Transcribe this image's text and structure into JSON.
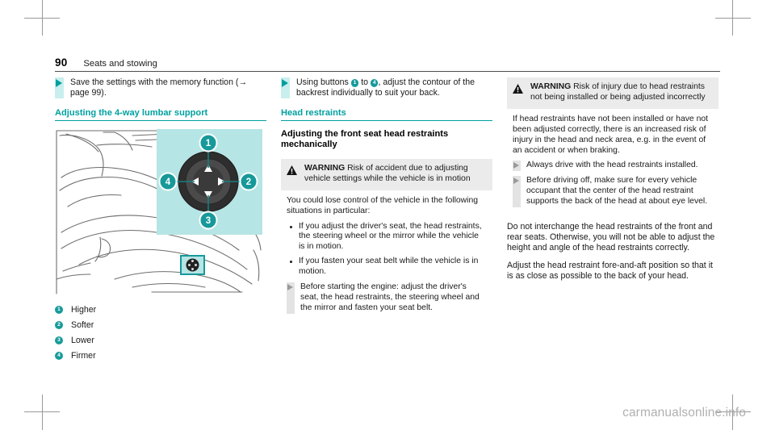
{
  "page": {
    "number": "90",
    "chapter": "Seats and stowing",
    "watermark": "carmanualsonline.info"
  },
  "colors": {
    "teal": "#00a0a0",
    "teal_badge": "#179b9b",
    "teal_tint": "#c9eeee",
    "warn_head_bg": "#ebebeb",
    "gray_marker": "#9a9a9a"
  },
  "left_column": {
    "step": {
      "text": "Save the settings with the memory function (→ page 99)."
    },
    "heading": "Adjusting the 4-way lumbar support",
    "figure": {
      "name": "4-way-lumbar-support-control",
      "callouts": [
        "1",
        "2",
        "3",
        "4"
      ],
      "arrow_directions": [
        "up",
        "right",
        "down",
        "left"
      ]
    },
    "legend": [
      {
        "num": "1",
        "label": "Higher"
      },
      {
        "num": "2",
        "label": "Softer"
      },
      {
        "num": "3",
        "label": "Lower"
      },
      {
        "num": "4",
        "label": "Firmer"
      }
    ]
  },
  "middle_column": {
    "step": {
      "prefix": "Using buttons",
      "badge_from": "1",
      "mid": "to",
      "badge_to": "4",
      "suffix": ", adjust the contour of the backrest individually to suit your back."
    },
    "heading": "Head restraints",
    "sub_heading": "Adjusting the front seat head restraints mechanically",
    "warning": {
      "label": "WARNING",
      "title": "Risk of accident due to adjusting vehicle settings while the vehicle is in motion",
      "intro": "You could lose control of the vehicle in the following situations in particular:",
      "bullets": [
        "If you adjust the driver's seat, the head restraints, the steering wheel or the mirror while the vehicle is in motion.",
        "If you fasten your seat belt while the vehicle is in motion."
      ],
      "steps": [
        "Before starting the engine: adjust the driver's seat, the head restraints, the steering wheel and the mirror and fasten your seat belt."
      ]
    }
  },
  "right_column": {
    "warning": {
      "label": "WARNING",
      "title": "Risk of injury due to head restraints not being installed or being adjusted incorrectly",
      "intro": "If head restraints have not been installed or have not been adjusted correctly, there is an increased risk of injury in the head and neck area, e.g. in the event of an accident or when braking.",
      "steps": [
        "Always drive with the head restraints installed.",
        "Before driving off, make sure for every vehicle occupant that the center of the head restraint supports the back of the head at about eye level."
      ]
    },
    "paragraphs": [
      "Do not interchange the head restraints of the front and rear seats. Otherwise, you will not be able to adjust the height and angle of the head restraints correctly.",
      "Adjust the head restraint fore-and-aft position so that it is as close as possible to the back of your head."
    ]
  }
}
